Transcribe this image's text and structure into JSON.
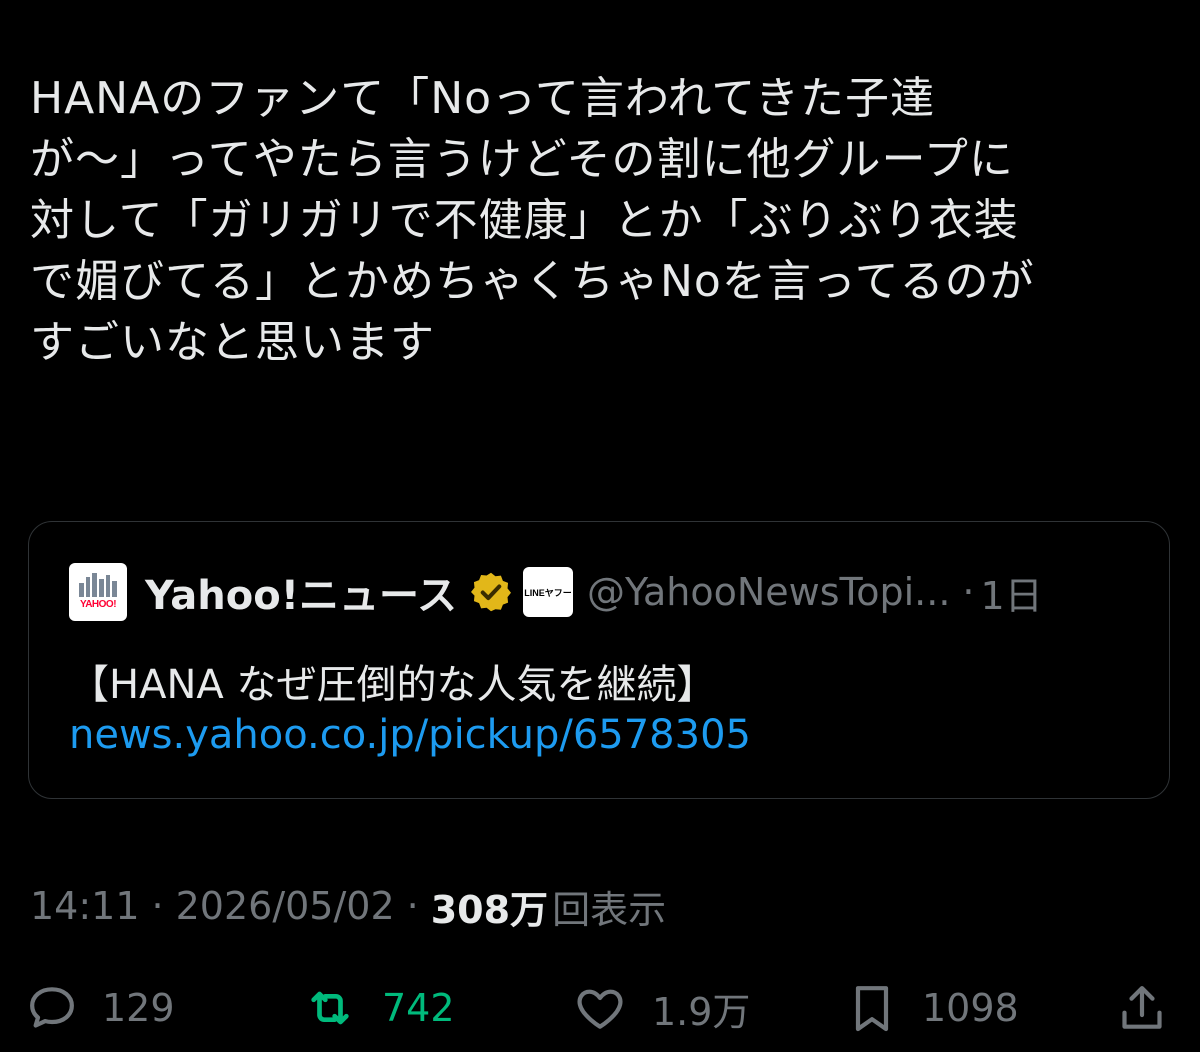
{
  "tweet": {
    "lines": [
      "HANAのファンて「Noって言われてきた子達",
      "が〜」ってやたら言うけどその割に他グループに",
      "対して「ガリガリで不健康」とか「ぶりぶり衣装",
      "で媚びてる」とかめちゃくちゃNoを言ってるのが",
      "すごいなと思います"
    ]
  },
  "quote": {
    "avatar_text": "YAHOO!",
    "display_name": "Yahoo!ニュース",
    "affiliate_badge_text": "LINEヤフー",
    "handle": "@YahooNewsTopi...",
    "separator": "·",
    "time": "1日",
    "title": "【HANA なぜ圧倒的な人気を継続】",
    "link": "news.yahoo.co.jp/pickup/6578305"
  },
  "meta": {
    "time": "14:11",
    "separator": "·",
    "date": "2026/05/02",
    "views_count": "308万",
    "views_label": "回表示"
  },
  "actions": {
    "replies": "129",
    "retweets": "742",
    "likes": "1.9万",
    "bookmarks": "1098"
  },
  "colors": {
    "background": "#000000",
    "text": "#e7e9ea",
    "muted": "#71767b",
    "link": "#1d9bf0",
    "retweet_active": "#00ba7c",
    "verified_gold": "#e2b719"
  },
  "icons": {
    "reply": "speech-bubble-icon",
    "retweet": "retweet-arrows-icon",
    "like": "heart-icon",
    "bookmark": "bookmark-icon",
    "share": "share-upload-icon",
    "verified": "verified-badge-icon"
  }
}
